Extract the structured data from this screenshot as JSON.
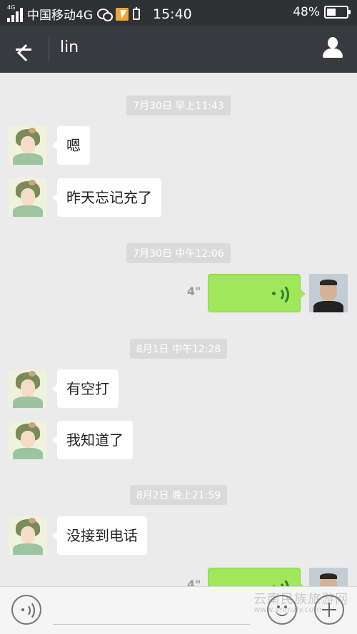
{
  "status_bar": {
    "network_badge": "4G",
    "carrier": "中国移动4G",
    "time": "15:40",
    "battery": "48%",
    "battery_level": 0.48
  },
  "header": {
    "title": "lin",
    "back_icon": "arrow-left-icon",
    "profile_icon": "person-icon"
  },
  "messages": [
    {
      "type": "timestamp",
      "text": "7月30日 早上11:43"
    },
    {
      "type": "text",
      "direction": "incoming",
      "text": "嗯"
    },
    {
      "type": "text",
      "direction": "incoming",
      "text": "昨天忘记充了"
    },
    {
      "type": "timestamp",
      "text": "7月30日 中午12:06"
    },
    {
      "type": "voice",
      "direction": "outgoing",
      "duration": "4\""
    },
    {
      "type": "timestamp",
      "text": "8月1日 中午12:28"
    },
    {
      "type": "text",
      "direction": "incoming",
      "text": "有空打"
    },
    {
      "type": "text",
      "direction": "incoming",
      "text": "我知道了"
    },
    {
      "type": "timestamp",
      "text": "8月2日 晚上21:59"
    },
    {
      "type": "text",
      "direction": "incoming",
      "text": "没接到电话"
    },
    {
      "type": "voice",
      "direction": "outgoing",
      "duration": "4\""
    }
  ],
  "input_bar": {
    "voice_icon": "voice-toggle-icon",
    "emoji_icon": "emoji-icon",
    "plus_icon": "plus-icon"
  },
  "watermark": {
    "text": "云南民族旅游网",
    "sub": "www.ynmzly.com"
  },
  "colors": {
    "outgoing_bubble": "#a0e75a",
    "header": "#393a3f",
    "background": "#ebebeb"
  }
}
